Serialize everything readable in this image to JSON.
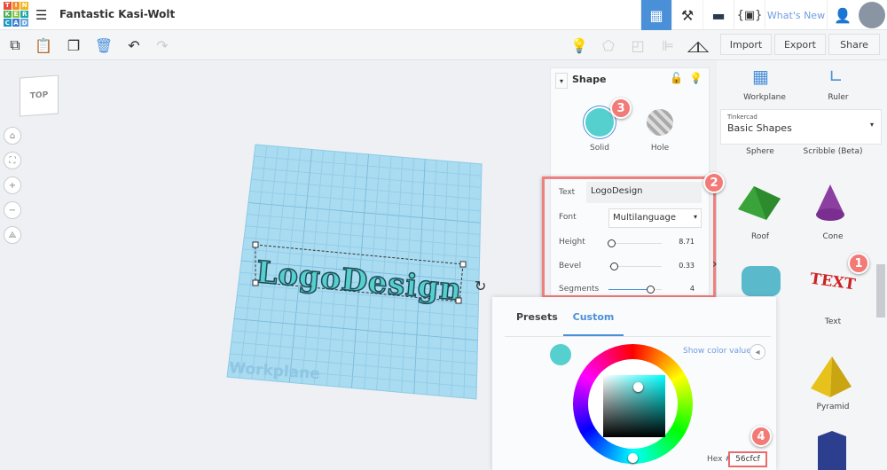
{
  "app": {
    "logo_letters": [
      "T",
      "I",
      "N",
      "K",
      "E",
      "R",
      "C",
      "A",
      "D"
    ],
    "title": "Fantastic Kasi-Wolt"
  },
  "header": {
    "whats_new": "What's New",
    "nav_icons": [
      "grid-icon",
      "pickaxe-icon",
      "brick-icon",
      "codeblocks-icon"
    ]
  },
  "toolbar": {
    "import": "Import",
    "export": "Export",
    "share": "Share"
  },
  "view": {
    "top_label": "TOP",
    "workplane_label": "Workplane",
    "object_text": "LogoDesign"
  },
  "shape_panel": {
    "title": "Shape",
    "solid": "Solid",
    "hole": "Hole",
    "text_label": "Text",
    "text_value": "LogoDesign",
    "font_label": "Font",
    "font_value": "Multilanguage",
    "height_label": "Height",
    "height_value": "8.71",
    "bevel_label": "Bevel",
    "bevel_value": "0.33",
    "segments_label": "Segments",
    "segments_value": "4",
    "color": "#56cfcf"
  },
  "sidebar": {
    "workplane": "Workplane",
    "ruler": "Ruler",
    "library_owner": "Tinkercad",
    "library": "Basic Shapes",
    "shapes": [
      "Sphere",
      "Scribble (Beta)",
      "Roof",
      "Cone",
      "Text",
      "Pyramid"
    ]
  },
  "picker": {
    "tab_presets": "Presets",
    "tab_custom": "Custom",
    "show_values": "Show color values",
    "hex_label": "Hex #",
    "hex_value": "56cfcf"
  },
  "badges": [
    "1",
    "2",
    "3",
    "4"
  ],
  "colors": {
    "accent": "#4a90d9",
    "badge": "#f27b78",
    "solid": "#56cfcf"
  }
}
